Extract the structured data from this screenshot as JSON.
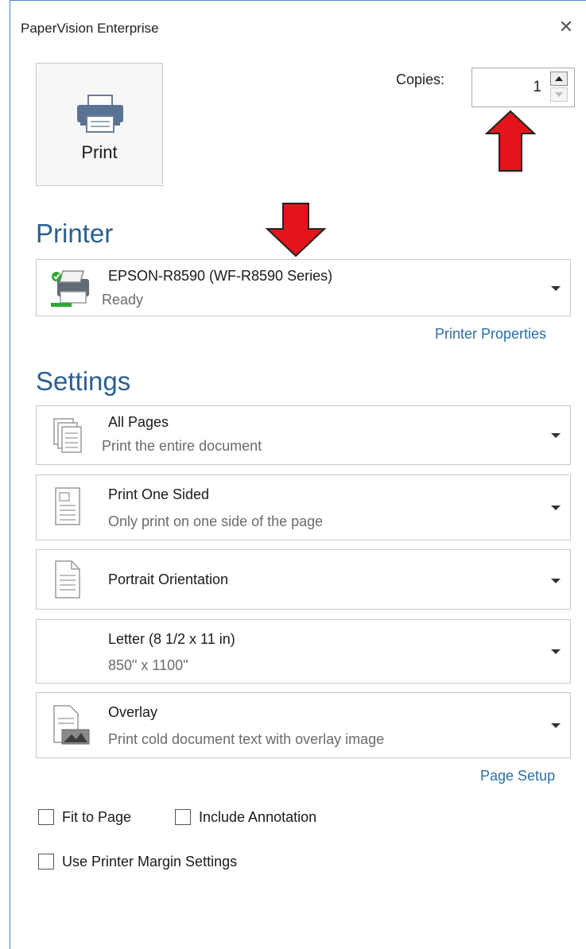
{
  "window": {
    "title": "PaperVision Enterprise",
    "close_glyph": "✕"
  },
  "print_button": {
    "label": "Print",
    "icon": "printer-icon"
  },
  "copies": {
    "label": "Copies:",
    "value": "1"
  },
  "printer": {
    "heading": "Printer",
    "selected_name": "EPSON-R8590 (WF-R8590 Series)",
    "status": "Ready",
    "properties_link": "Printer Properties"
  },
  "settings": {
    "heading": "Settings",
    "pages": {
      "title": "All Pages",
      "subtitle": "Print the entire document"
    },
    "sides": {
      "title": "Print One Sided",
      "subtitle": "Only print on one side of the page"
    },
    "orientation": {
      "title": "Portrait Orientation"
    },
    "paper": {
      "title": "Letter (8 1/2 x 11 in)",
      "subtitle": "850\" x 1100\""
    },
    "overlay": {
      "title": "Overlay",
      "subtitle": "Print cold document text with overlay image"
    },
    "page_setup_link": "Page Setup"
  },
  "options": {
    "fit_to_page": "Fit to Page",
    "include_annotation": "Include Annotation",
    "use_printer_margins": "Use Printer Margin Settings"
  },
  "colors": {
    "accent": "#2c5f91",
    "link": "#2c6ea8",
    "annotation_arrow": "#e3141a"
  }
}
